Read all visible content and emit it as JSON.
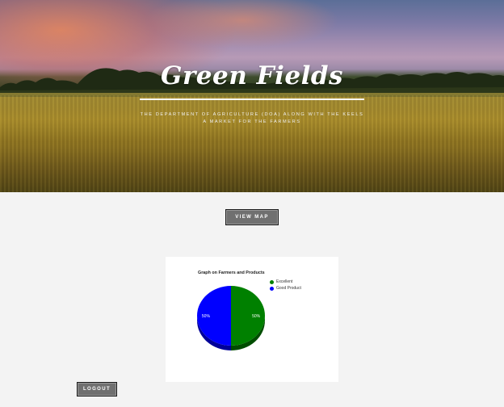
{
  "hero": {
    "title": "Green Fields",
    "subtitle_line1": "THE DEPARTMENT OF AGRICULTURE (DOA) ALONG WITH THE KEELS",
    "subtitle_line2": "A MARKET FOR THE FARMERS"
  },
  "actions": {
    "view_map_label": "VIEW MAP",
    "logout_label": "LOGOUT"
  },
  "chart_data": {
    "type": "pie",
    "title": "Graph on Farmers and Products",
    "categories": [
      "Excellent",
      "Good Product"
    ],
    "values": [
      50,
      50
    ],
    "labels": [
      "50%",
      "50%"
    ],
    "colors": [
      "#008000",
      "#0000ff"
    ],
    "legend": "right"
  }
}
